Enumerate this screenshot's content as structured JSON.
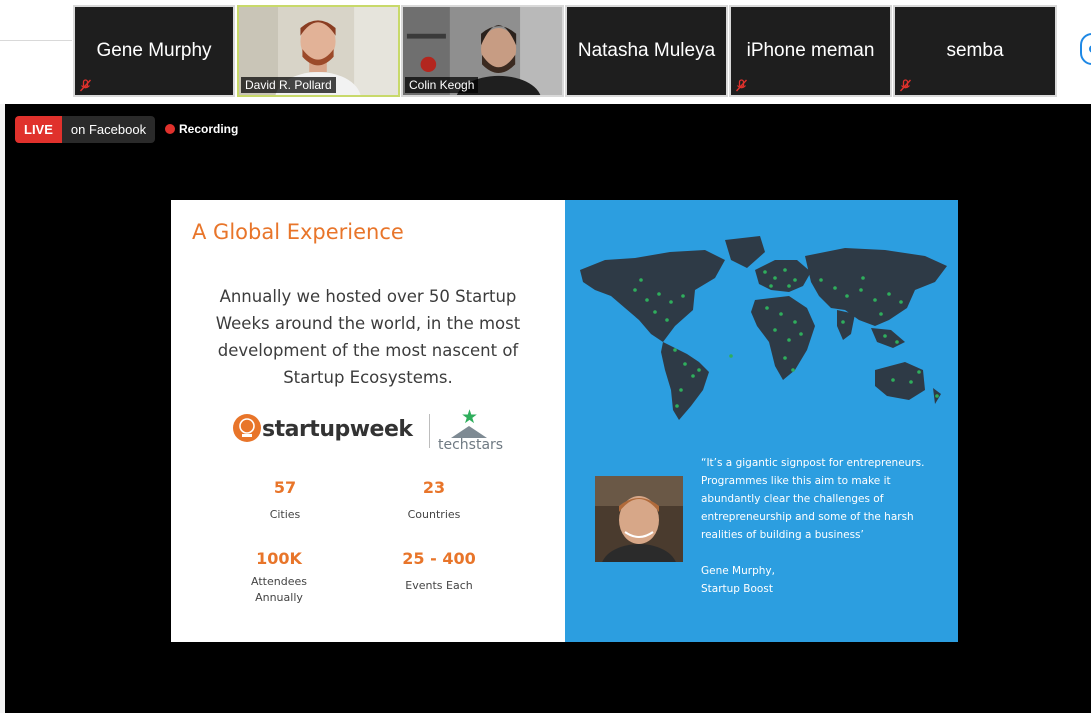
{
  "participants": [
    {
      "name": "Gene Murphy",
      "muted": true
    },
    {
      "name": "David R. Pollard",
      "muted": false,
      "video": true,
      "active": true
    },
    {
      "name": "Colin Keogh",
      "muted": false,
      "video": true
    },
    {
      "name": "Natasha Muleya",
      "muted": false
    },
    {
      "name": "iPhone meman",
      "muted": true
    },
    {
      "name": "semba",
      "muted": true
    }
  ],
  "stream": {
    "live_label": "LIVE",
    "destination": "on Facebook",
    "recording_label": "Recording"
  },
  "slide": {
    "title": "A Global Experience",
    "body_lines": [
      "Annually we hosted over 50 Startup",
      "Weeks around the world, in the most",
      "development of the most nascent of",
      "Startup Ecosystems."
    ],
    "logo_primary": "startupweek",
    "logo_secondary": "techstars",
    "stats": [
      {
        "value": "57",
        "label_lines": [
          "Cities"
        ]
      },
      {
        "value": "23",
        "label_lines": [
          "Countries"
        ]
      },
      {
        "value": "100K",
        "label_lines": [
          "Attendees",
          "Annually"
        ]
      },
      {
        "value": "25 - 400",
        "label_lines": [
          "Events Each"
        ]
      }
    ],
    "quote_lines": [
      "“It’s a gigantic signpost for entrepreneurs.",
      "Programmes like this aim to make it",
      "abundantly clear the challenges of",
      "entrepreneurship and some of the harsh",
      "realities of building a business’"
    ],
    "attribution_lines": [
      "Gene Murphy,",
      "Startup Boost"
    ]
  },
  "colors": {
    "accent_orange": "#e8752a",
    "slide_blue": "#2c9ee0",
    "live_red": "#e0312c",
    "active_border": "#c8d96a"
  }
}
